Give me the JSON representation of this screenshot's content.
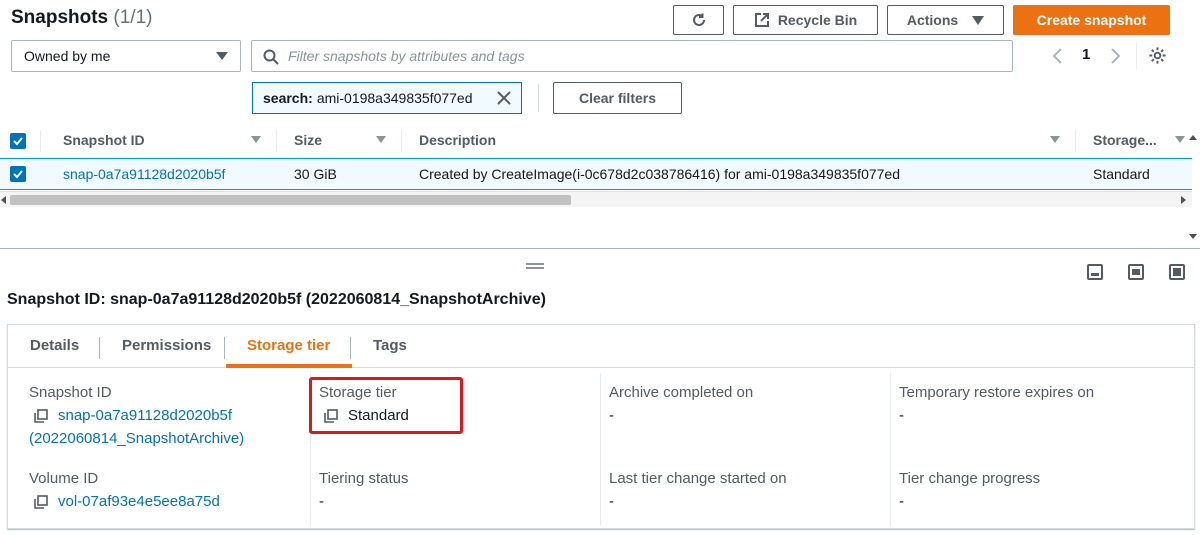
{
  "header": {
    "title": "Snapshots",
    "count": "(1/1)",
    "refresh_icon": "refresh-icon",
    "recycle_bin_label": "Recycle Bin",
    "actions_label": "Actions",
    "create_label": "Create snapshot"
  },
  "filter": {
    "owner_select": "Owned by me",
    "search_placeholder": "Filter snapshots by attributes and tags",
    "page_number": "1",
    "token_key": "search:",
    "token_value": "ami-0198a349835f077ed",
    "clear_filters_label": "Clear filters"
  },
  "table": {
    "columns": [
      "Snapshot ID",
      "Size",
      "Description",
      "Storage..."
    ],
    "rows": [
      {
        "snapshot_id": "snap-0a7a91128d2020b5f",
        "size": "30 GiB",
        "description": "Created by CreateImage(i-0c678d2c038786416) for ami-0198a349835f077ed",
        "storage": "Standard"
      }
    ]
  },
  "detail": {
    "title": "Snapshot ID: snap-0a7a91128d2020b5f (2022060814_SnapshotArchive)",
    "tabs": [
      "Details",
      "Permissions",
      "Storage tier",
      "Tags"
    ],
    "active_tab": "Storage tier",
    "fields": {
      "snapshot_id_label": "Snapshot ID",
      "snapshot_id_line1": "snap-0a7a91128d2020b5f",
      "snapshot_id_line2": "(2022060814_SnapshotArchive)",
      "storage_tier_label": "Storage tier",
      "storage_tier_value": "Standard",
      "archive_completed_label": "Archive completed on",
      "archive_completed_value": "-",
      "temp_restore_label": "Temporary restore expires on",
      "temp_restore_value": "-",
      "volume_id_label": "Volume ID",
      "volume_id_value": "vol-07af93e4e5ee8a75d",
      "tiering_status_label": "Tiering status",
      "tiering_status_value": "-",
      "last_tier_change_label": "Last tier change started on",
      "last_tier_change_value": "-",
      "tier_progress_label": "Tier change progress",
      "tier_progress_value": "-"
    }
  },
  "colors": {
    "accent": "#ec7211",
    "link": "#0073bb",
    "highlight": "#e0161d"
  }
}
